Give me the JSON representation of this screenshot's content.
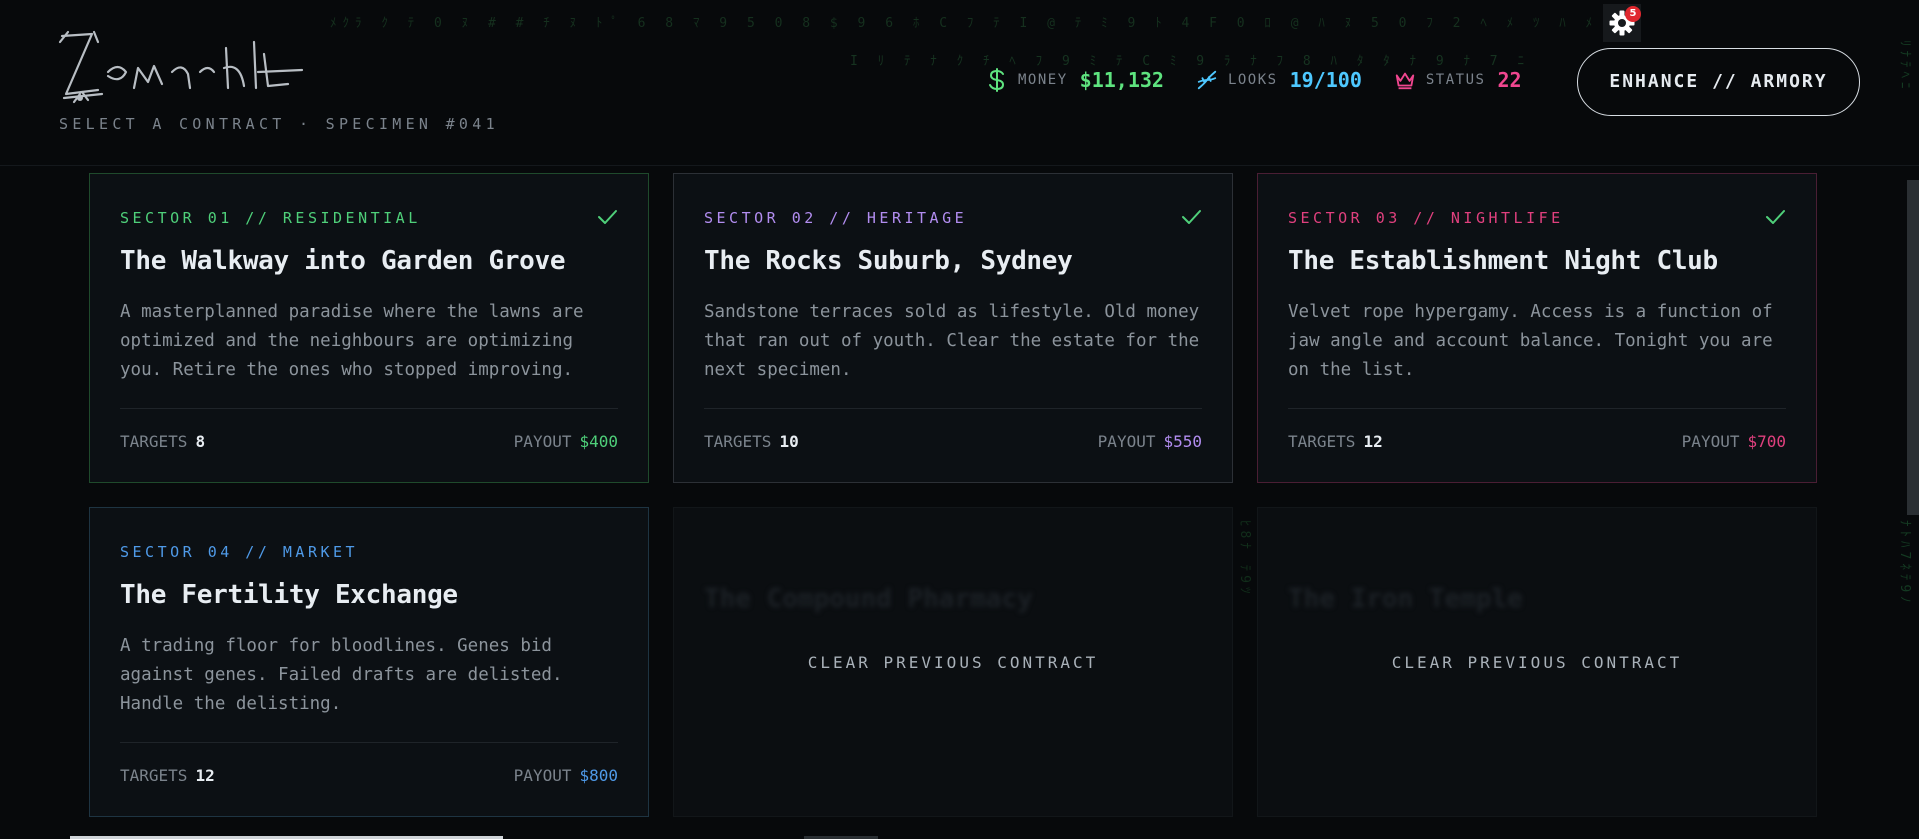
{
  "header": {
    "logo_text": "Zomacht",
    "subtitle": "SELECT A CONTRACT · SPECIMEN #041",
    "stats": [
      {
        "icon": "dollar-icon",
        "label": "MONEY",
        "value": "$11,132",
        "color": "#5ee37f"
      },
      {
        "icon": "dna-icon",
        "label": "LOOKS",
        "value": "19/100",
        "color": "#4ec8ff"
      },
      {
        "icon": "crown-icon",
        "label": "STATUS",
        "value": "22",
        "color": "#f0468f"
      }
    ],
    "armory_label": "ENHANCE // ARMORY",
    "settings_badge": "5"
  },
  "cards": [
    {
      "sector": "SECTOR 01 // RESIDENTIAL",
      "accent": "#4fd07a",
      "title": "The Walkway into Garden Grove",
      "desc": "A masterplanned paradise where the lawns are optimized and the neighbours are optimizing you. Retire the ones who stopped improving.",
      "targets_label": "TARGETS",
      "targets": "8",
      "payout_label": "PAYOUT",
      "payout": "$400",
      "completed": true
    },
    {
      "sector": "SECTOR 02 // HERITAGE",
      "accent": "#b28df0",
      "title": "The Rocks Suburb, Sydney",
      "desc": "Sandstone terraces sold as lifestyle. Old money that ran out of youth. Clear the estate for the next specimen.",
      "targets_label": "TARGETS",
      "targets": "10",
      "payout_label": "PAYOUT",
      "payout": "$550",
      "completed": true
    },
    {
      "sector": "SECTOR 03 // NIGHTLIFE",
      "accent": "#e0407e",
      "title": "The Establishment Night Club",
      "desc": "Velvet rope hypergamy. Access is a function of jaw angle and account balance. Tonight you are on the list.",
      "targets_label": "TARGETS",
      "targets": "12",
      "payout_label": "PAYOUT",
      "payout": "$700",
      "completed": true
    },
    {
      "sector": "SECTOR 04 // MARKET",
      "accent": "#4f9ae8",
      "title": "The Fertility Exchange",
      "desc": "A trading floor for bloodlines. Genes bid against genes. Failed drafts are delisted. Handle the delisting.",
      "targets_label": "TARGETS",
      "targets": "12",
      "payout_label": "PAYOUT",
      "payout": "$800",
      "completed": false
    }
  ],
  "locked_cards": [
    {
      "lock_text": "CLEAR PREVIOUS CONTRACT",
      "ghost_title": "The Compound Pharmacy"
    },
    {
      "lock_text": "CLEAR PREVIOUS CONTRACT",
      "ghost_title": "The Iron Temple"
    }
  ]
}
